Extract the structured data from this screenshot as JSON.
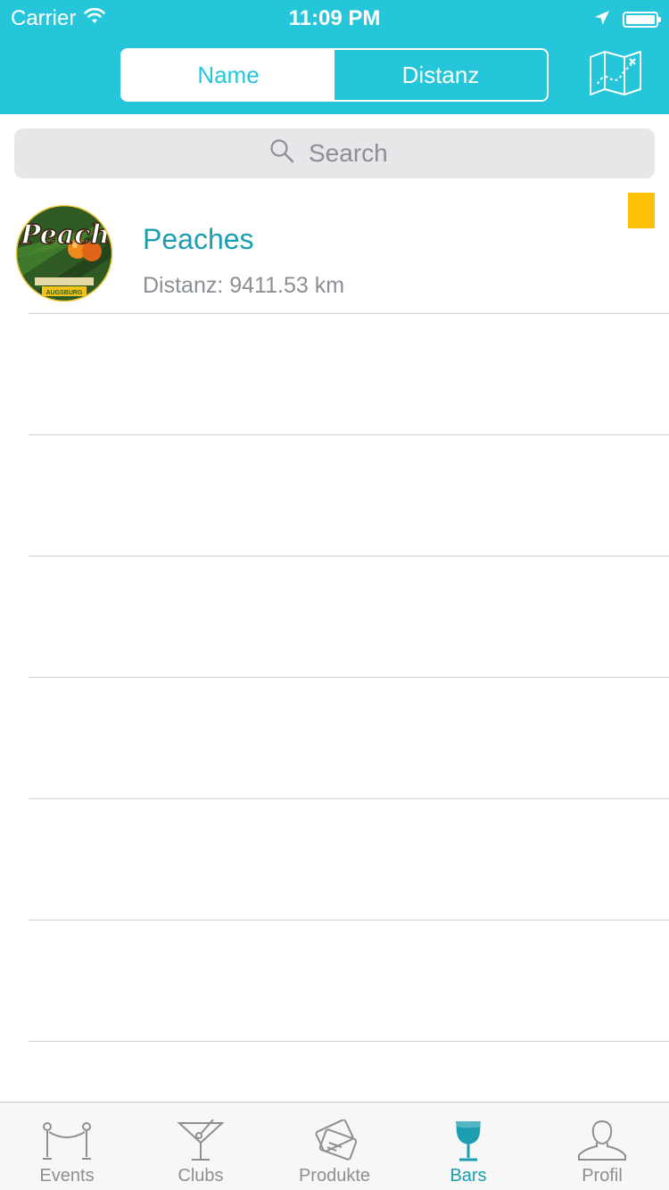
{
  "status_bar": {
    "carrier": "Carrier",
    "time": "11:09 PM"
  },
  "nav": {
    "segments": [
      {
        "label": "Name",
        "selected": true
      },
      {
        "label": "Distanz",
        "selected": false
      }
    ],
    "map_icon": "map-icon"
  },
  "search": {
    "placeholder": "Search"
  },
  "list": {
    "items": [
      {
        "title": "Peaches",
        "subtitle": "Distanz: 9411.53 km",
        "logo_text": "Peaches",
        "logo_subtext": "AUGSBURG",
        "badge_color": "#FFC107"
      }
    ]
  },
  "tabs": [
    {
      "label": "Events",
      "icon": "rope-barrier-icon",
      "active": false
    },
    {
      "label": "Clubs",
      "icon": "cocktail-glass-icon",
      "active": false
    },
    {
      "label": "Produkte",
      "icon": "tickets-icon",
      "active": false
    },
    {
      "label": "Bars",
      "icon": "wine-glass-icon",
      "active": true
    },
    {
      "label": "Profil",
      "icon": "person-icon",
      "active": false
    }
  ],
  "colors": {
    "accent": "#26C6DA",
    "active_tab": "#1A9EB0",
    "badge": "#FFC107"
  }
}
